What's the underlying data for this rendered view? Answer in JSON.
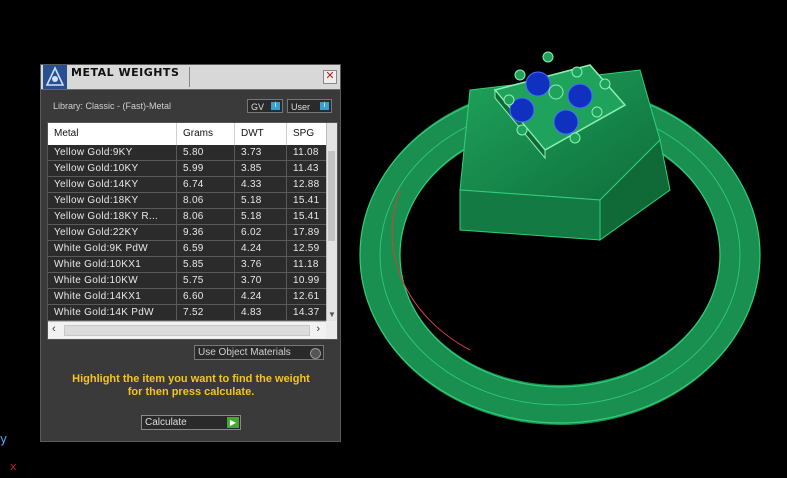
{
  "panel": {
    "title": "METAL WEIGHTS",
    "close_glyph": "✕",
    "library_label": "Library: Classic - (Fast)-Metal",
    "gv_label": "GV",
    "user_label": "User",
    "table": {
      "headers": [
        "Metal",
        "Grams",
        "DWT",
        "SPG"
      ],
      "rows": [
        [
          "Yellow Gold:9KY",
          "5.80",
          "3.73",
          "11.08"
        ],
        [
          "Yellow Gold:10KY",
          "5.99",
          "3.85",
          "11.43"
        ],
        [
          "Yellow Gold:14KY",
          "6.74",
          "4.33",
          "12.88"
        ],
        [
          "Yellow Gold:18KY",
          "8.06",
          "5.18",
          "15.41"
        ],
        [
          "Yellow Gold:18KY R...",
          "8.06",
          "5.18",
          "15.41"
        ],
        [
          "Yellow Gold:22KY",
          "9.36",
          "6.02",
          "17.89"
        ],
        [
          "White Gold:9K PdW",
          "6.59",
          "4.24",
          "12.59"
        ],
        [
          "White Gold:10KX1",
          "5.85",
          "3.76",
          "11.18"
        ],
        [
          "White Gold:10KW",
          "5.75",
          "3.70",
          "10.99"
        ],
        [
          "White Gold:14KX1",
          "6.60",
          "4.24",
          "12.61"
        ],
        [
          "White Gold:14K PdW",
          "7.52",
          "4.83",
          "14.37"
        ]
      ]
    },
    "use_object_materials": "Use Object Materials",
    "hint_line1": "Highlight the item you want to find the weight",
    "hint_line2": "for then press calculate.",
    "calculate_label": "Calculate"
  },
  "axis": {
    "y": "y",
    "x": "x"
  },
  "colors": {
    "ring_green": "#1a8a4e",
    "stone_blue": "#1030c0",
    "hint_yellow": "#f5c51b"
  }
}
